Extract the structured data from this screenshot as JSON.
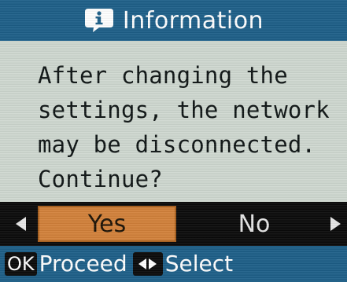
{
  "header": {
    "title": "Information",
    "icon": "info-speech-bubble-icon"
  },
  "message": {
    "lines": [
      "After changing the",
      "settings, the network",
      "may be disconnected.",
      "Continue?"
    ]
  },
  "choices": {
    "yes_label": "Yes",
    "no_label": "No",
    "selected": "Yes",
    "left_arrow_icon": "arrow-left-icon",
    "right_arrow_icon": "arrow-right-icon"
  },
  "footer": {
    "ok_key": "OK",
    "proceed_label": "Proceed",
    "select_icon": "left-right-arrows-icon",
    "select_label": "Select"
  },
  "colors": {
    "header_bg": "#1d5f88",
    "body_bg": "#cfd8d0",
    "choice_bar_bg": "#0a0a0a",
    "selected_bg": "#d2813a",
    "footer_bg": "#1d5f88"
  }
}
